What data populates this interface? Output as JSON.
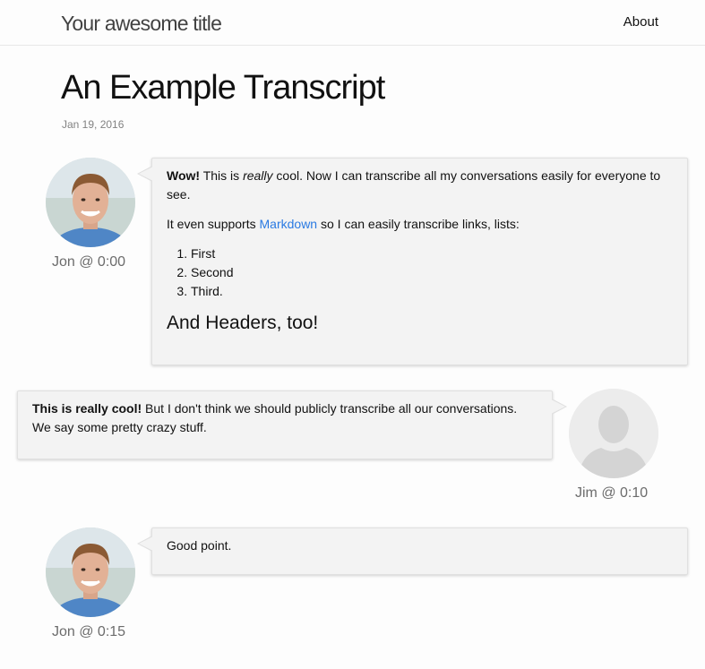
{
  "header": {
    "site_title": "Your awesome title",
    "nav_about": "About"
  },
  "post": {
    "title": "An Example Transcript",
    "date": "Jan 19, 2016"
  },
  "messages": [
    {
      "speaker": "Jon @ 0:00",
      "avatar": "person-photo-jon",
      "intro_bold": "Wow!",
      "intro_a": "This is",
      "intro_em": "really",
      "intro_b": "cool. Now I can transcribe all my conversations easily for everyone to see.",
      "p2_before": "It even supports",
      "p2_link": "Markdown",
      "p2_after": "so I can easily transcribe links, lists:",
      "list": [
        "First",
        "Second",
        "Third."
      ],
      "heading": "And Headers, too!"
    },
    {
      "speaker": "Jim @ 0:10",
      "avatar": "default-user-silhouette-icon",
      "text_bold": "This is really cool!",
      "text": "But I don't think we should publicly transcribe all our conversations. We say some pretty crazy stuff."
    },
    {
      "speaker": "Jon @ 0:15",
      "avatar": "person-photo-jon",
      "text": "Good point."
    }
  ],
  "colors": {
    "link": "#2a7ae2",
    "bubble_bg": "#f3f3f3",
    "speaker_text": "#6c6c6c",
    "meta_text": "#828282"
  }
}
